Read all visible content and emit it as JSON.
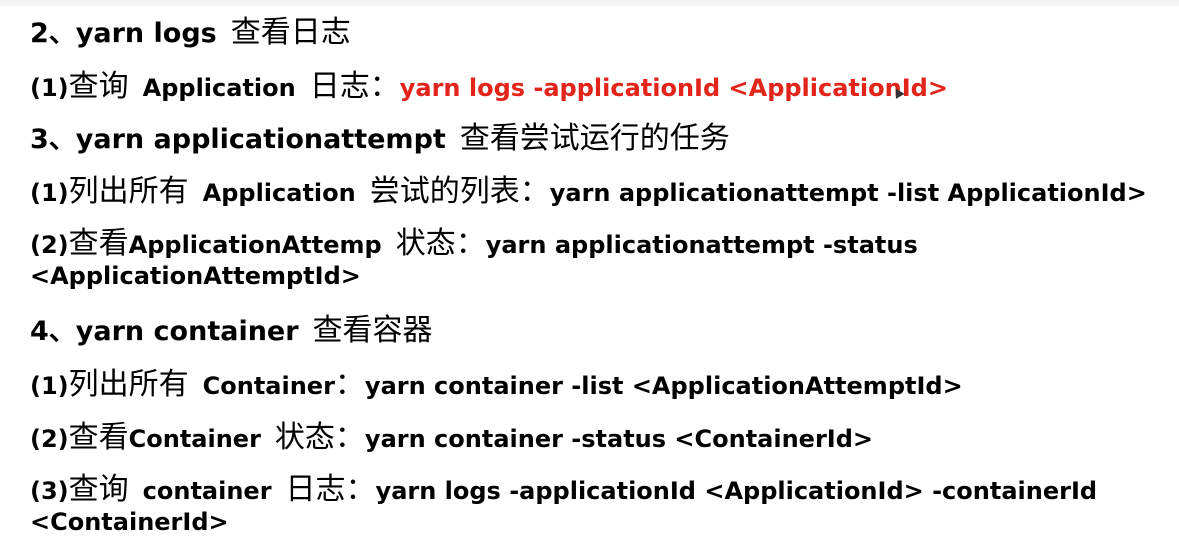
{
  "doc": {
    "s2_title_num": "2、yarn logs",
    "s2_title_cn": "查看日志",
    "s2_i1_num": "(1)",
    "s2_i1_cn": "查询",
    "s2_i1_app": "Application",
    "s2_i1_cn2": "日志：",
    "s2_i1_cmd": "yarn logs -applicationId <ApplicationId>",
    "s3_title_num": "3、yarn applicationattempt",
    "s3_title_cn": "查看尝试运行的任务",
    "s3_i1_num": "(1)",
    "s3_i1_cn": "列出所有",
    "s3_i1_app": "Application",
    "s3_i1_cn2": "尝试的列表：",
    "s3_i1_cmd": "yarn applicationattempt -list ApplicationId>",
    "s3_i2_num": "(2)",
    "s3_i2_cn": "查看",
    "s3_i2_app": "ApplicationAttemp",
    "s3_i2_cn2": "状态：",
    "s3_i2_cmd": "yarn applicationattempt -status",
    "s3_i2_cmd2": "<ApplicationAttemptId>",
    "s4_title_num": "4、yarn container",
    "s4_title_cn": "查看容器",
    "s4_i1_num": "(1)",
    "s4_i1_cn": "列出所有",
    "s4_i1_app": "Container",
    "s4_i1_cn2": "：",
    "s4_i1_cmd": "yarn container -list <ApplicationAttemptId>",
    "s4_i2_num": "(2)",
    "s4_i2_cn": "查看",
    "s4_i2_app": "Container",
    "s4_i2_cn2": "状态：",
    "s4_i2_cmd": "yarn container -status <ContainerId>",
    "s4_i3_num": "(3)",
    "s4_i3_cn": "查询",
    "s4_i3_app": "container",
    "s4_i3_cn2": "日志：",
    "s4_i3_cmd": "yarn logs -applicationId <ApplicationId> -containerId",
    "s4_i3_cmd2": "<ContainerId>"
  },
  "colors": {
    "command_highlight": "#e3241b",
    "text": "#000000"
  }
}
